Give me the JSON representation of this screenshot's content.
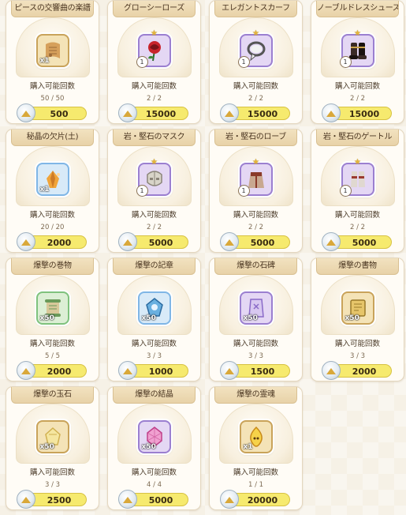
{
  "shop": {
    "currency_icon": "crystal-coin-icon",
    "items": [
      {
        "title": "ピースの交響曲の楽譜",
        "qty": "x1",
        "label": "購入可能回数",
        "count": "50 / 50",
        "price": "500",
        "icon": "sheet-music-icon",
        "frame": "gold",
        "colors": [
          "#d6a05b",
          "#9b6a3a"
        ],
        "star": false,
        "badge": ""
      },
      {
        "title": "グローシーローズ",
        "qty": "",
        "label": "購入可能回数",
        "count": "2 / 2",
        "price": "15000",
        "icon": "rose-icon",
        "frame": "purple",
        "colors": [
          "#c8242b",
          "#7a1418"
        ],
        "star": true,
        "badge": "1"
      },
      {
        "title": "エレガントスカーフ",
        "qty": "",
        "label": "購入可能回数",
        "count": "2 / 2",
        "price": "15000",
        "icon": "scarf-icon",
        "frame": "purple",
        "colors": [
          "#f2f2f2",
          "#555555"
        ],
        "star": true,
        "badge": "1"
      },
      {
        "title": "ノーブルドレスシューズ",
        "qty": "",
        "label": "購入可能回数",
        "count": "2 / 2",
        "price": "15000",
        "icon": "dress-shoes-icon",
        "frame": "purple",
        "colors": [
          "#3a2a26",
          "#1a1210"
        ],
        "star": true,
        "badge": "1"
      },
      {
        "title": "秘晶の欠片(土)",
        "qty": "x1",
        "label": "購入可能回数",
        "count": "20 / 20",
        "price": "2000",
        "icon": "crystal-shard-earth-icon",
        "frame": "blue",
        "colors": [
          "#f0a43a",
          "#b5601a"
        ],
        "star": false,
        "badge": ""
      },
      {
        "title": "岩・堅石のマスク",
        "qty": "",
        "label": "購入可能回数",
        "count": "2 / 2",
        "price": "5000",
        "icon": "rock-mask-icon",
        "frame": "purple",
        "colors": [
          "#d8d4c8",
          "#8a8478"
        ],
        "star": true,
        "badge": "1"
      },
      {
        "title": "岩・堅石のローブ",
        "qty": "",
        "label": "購入可能回数",
        "count": "2 / 2",
        "price": "5000",
        "icon": "rock-robe-icon",
        "frame": "purple",
        "colors": [
          "#c8a890",
          "#8a3a2a"
        ],
        "star": true,
        "badge": "1"
      },
      {
        "title": "岩・堅石のゲートル",
        "qty": "",
        "label": "購入可能回数",
        "count": "2 / 2",
        "price": "5000",
        "icon": "rock-gaiter-icon",
        "frame": "purple",
        "colors": [
          "#e0d8d0",
          "#9a3a30"
        ],
        "star": true,
        "badge": "1"
      },
      {
        "title": "爆撃の巻物",
        "qty": "x50",
        "label": "購入可能回数",
        "count": "5 / 5",
        "price": "2000",
        "icon": "scroll-icon",
        "frame": "green",
        "colors": [
          "#d8c89a",
          "#6a9a5a"
        ],
        "star": false,
        "badge": ""
      },
      {
        "title": "爆撃の記章",
        "qty": "x50",
        "label": "購入可能回数",
        "count": "3 / 3",
        "price": "1000",
        "icon": "insignia-icon",
        "frame": "blue",
        "colors": [
          "#6ab0e0",
          "#2a6aa0"
        ],
        "star": false,
        "badge": ""
      },
      {
        "title": "爆撃の石碑",
        "qty": "x50",
        "label": "購入可能回数",
        "count": "3 / 3",
        "price": "1500",
        "icon": "stone-tablet-icon",
        "frame": "purple",
        "colors": [
          "#d8c8f0",
          "#8a6ac8"
        ],
        "star": false,
        "badge": ""
      },
      {
        "title": "爆撃の書物",
        "qty": "x50",
        "label": "購入可能回数",
        "count": "3 / 3",
        "price": "2000",
        "icon": "book-icon",
        "frame": "gold",
        "colors": [
          "#e6c56a",
          "#9a7a2a"
        ],
        "star": false,
        "badge": ""
      },
      {
        "title": "爆撃の玉石",
        "qty": "x50",
        "label": "購入可能回数",
        "count": "3 / 3",
        "price": "2500",
        "icon": "gemstone-icon",
        "frame": "gold",
        "colors": [
          "#f5e6a0",
          "#d0b050"
        ],
        "star": false,
        "badge": ""
      },
      {
        "title": "爆撃の結晶",
        "qty": "x50",
        "label": "購入可能回数",
        "count": "4 / 4",
        "price": "5000",
        "icon": "crystal-icon",
        "frame": "purple",
        "colors": [
          "#f0a0d0",
          "#c0408a"
        ],
        "star": false,
        "badge": ""
      },
      {
        "title": "爆撃の霊魂",
        "qty": "x1",
        "label": "購入可能回数",
        "count": "1 / 1",
        "price": "20000",
        "icon": "spirit-flame-icon",
        "frame": "gold",
        "colors": [
          "#f6d24a",
          "#c88a1a"
        ],
        "star": false,
        "badge": ""
      }
    ]
  }
}
